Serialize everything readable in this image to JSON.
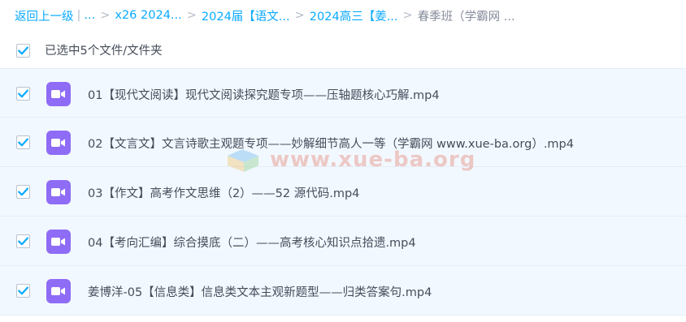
{
  "breadcrumb": {
    "back_label": "返回上一级",
    "separator_bar": "|",
    "ellipsis": "...",
    "crumbs": [
      "x26 2024...",
      "2024届【语文...",
      "2024高三【姜..."
    ],
    "current": "春季班（学霸网 ...",
    "separator": ">"
  },
  "selection": {
    "text": "已选中5个文件/文件夹",
    "checked": true
  },
  "files": [
    {
      "name": "01【现代文阅读】现代文阅读探究题专项——压轴题核心巧解.mp4",
      "checked": true,
      "icon": "video-file-icon"
    },
    {
      "name": "02【文言文】文言诗歌主观题专项——妙解细节高人一等（学霸网 www.xue-ba.org）.mp4",
      "checked": true,
      "icon": "video-file-icon"
    },
    {
      "name": "03【作文】高考作文思维（2）——52 源代码.mp4",
      "checked": true,
      "icon": "video-file-icon"
    },
    {
      "name": "04【考向汇编】综合摸底（二）——高考核心知识点拾遗.mp4",
      "checked": true,
      "icon": "video-file-icon"
    },
    {
      "name": "姜博洋-05【信息类】信息类文本主观新题型——归类答案句.mp4",
      "checked": true,
      "icon": "video-file-icon"
    }
  ],
  "watermark": {
    "text": "www.xue-ba.org"
  },
  "colors": {
    "accent": "#09aaff",
    "video_icon": "#8f6cf6",
    "row_bg": "#f2f8ff"
  }
}
